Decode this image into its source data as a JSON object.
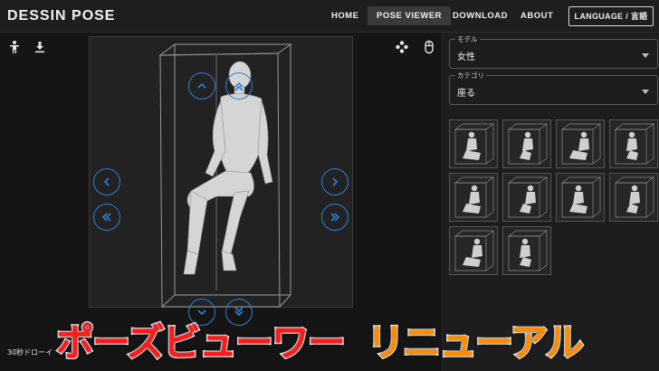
{
  "header": {
    "brand": "DESSIN POSE",
    "nav": [
      {
        "label": "HOME",
        "active": false
      },
      {
        "label": "POSE VIEWER",
        "active": true
      },
      {
        "label": "DOWNLOAD",
        "active": false
      },
      {
        "label": "ABOUT",
        "active": false
      }
    ],
    "language_label": "LANGUAGE / 言語"
  },
  "toolbar": {
    "icons": [
      "person-icon",
      "download-icon",
      "gamepad-icon",
      "mouse-icon"
    ]
  },
  "viewer": {
    "nav_buttons": [
      "rotate-up-button",
      "rotate-top-button",
      "rotate-left-button",
      "rotate-left-fast-button",
      "rotate-right-button",
      "rotate-right-fast-button",
      "rotate-down-button",
      "rotate-down-fast-button"
    ],
    "bottom_text": "30秒ドローイ"
  },
  "panel": {
    "model": {
      "label": "モデル",
      "value": "女性"
    },
    "category": {
      "label": "カテゴリ",
      "value": "座る"
    },
    "thumbnail_count": 10
  },
  "banner": {
    "part1": "ポーズビューワー",
    "part2": "リニューアル"
  },
  "colors": {
    "accent_blue": "#2f80d8",
    "banner_red": "#ff1a1a",
    "banner_orange": "#ff8c00"
  }
}
